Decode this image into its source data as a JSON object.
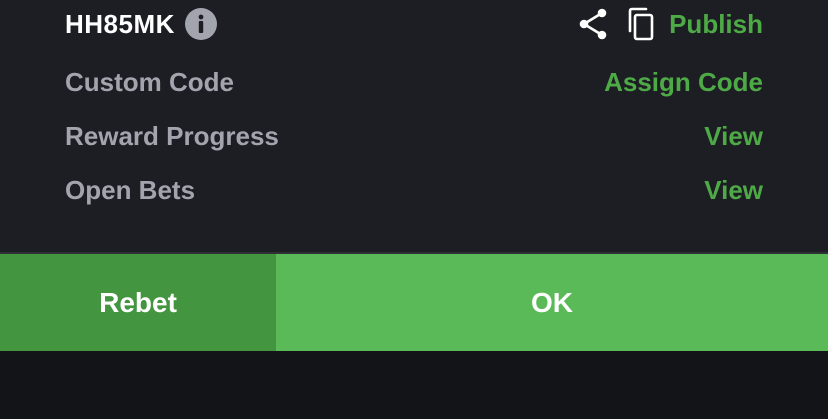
{
  "bet": {
    "code": "HH85MK",
    "info_icon": "info-circle-icon",
    "share_icon": "share-icon",
    "copy_icon": "copy-icon",
    "publish_label": "Publish"
  },
  "rows": [
    {
      "label": "Custom Code",
      "action": "Assign Code"
    },
    {
      "label": "Reward Progress",
      "action": "View"
    },
    {
      "label": "Open Bets",
      "action": "View"
    }
  ],
  "buttons": {
    "rebet_label": "Rebet",
    "ok_label": "OK"
  },
  "colors": {
    "accent_green": "#4eaa46",
    "rebet_bg": "#439540",
    "ok_bg": "#5aba58",
    "panel_bg": "#1d1e23",
    "label_gray": "#a3a5ae"
  }
}
